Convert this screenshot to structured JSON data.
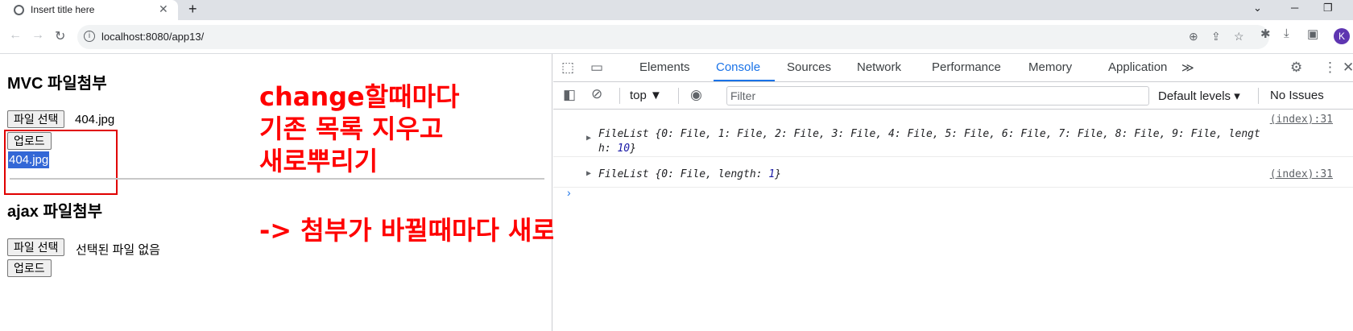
{
  "browser": {
    "tab_title": "Insert title here",
    "tab_close": "✕",
    "new_tab": "+",
    "url": "localhost:8080/app13/",
    "back_icon": "←",
    "forward_icon": "→",
    "reload_icon": "↻",
    "profile_initial": "K",
    "minimize": "─",
    "maximize": "❐",
    "dropdown": "⌄"
  },
  "page": {
    "mvc_heading": "MVC 파일첨부",
    "file_select_label": "파일 선택",
    "mvc_file_name": "404.jpg",
    "upload_label": "업로드",
    "selected_text": "404.jpg",
    "ajax_heading": "ajax 파일첨부",
    "ajax_file_status": "선택된 파일 없음"
  },
  "annotations": {
    "line1": "change할때마다",
    "line2": "기존 목록 지우고",
    "line3": "새로뿌리기",
    "line4": "-> 첨부가 바뀔때마다 새로 뿌리기!!"
  },
  "devtools": {
    "tabs": [
      "Elements",
      "Console",
      "Sources",
      "Network",
      "Performance",
      "Memory",
      "Application"
    ],
    "active_tab": "Console",
    "more_tabs": "≫",
    "context": "top ▼",
    "filter_placeholder": "Filter",
    "levels": "Default levels ▾",
    "issues": "No Issues",
    "logs": [
      {
        "source": "(index):31",
        "line1": "FileList {0: File, 1: File, 2: File, 3: File, 4: File, 5: File, 6: File, 7: File, 8: File, 9: File, lengt",
        "line2_prefix": "h: ",
        "line2_num": "10",
        "line2_suffix": "}"
      },
      {
        "source": "(index):31",
        "text_prefix": "FileList {0: File, length: ",
        "text_num": "1",
        "text_suffix": "}"
      }
    ],
    "prompt": "›"
  },
  "colors": {
    "annotation_red": "#ff0000",
    "accent_blue": "#1a73e8",
    "selection_blue": "#3367d6",
    "avatar_purple": "#5e35b1"
  }
}
